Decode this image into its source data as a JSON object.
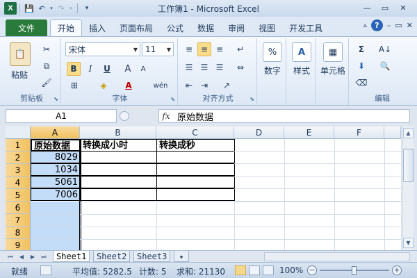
{
  "window": {
    "app_icon": "X",
    "title": "工作簿1 - Microsoft Excel",
    "qat_icons": [
      "save-icon",
      "undo-icon",
      "redo-icon",
      "customize-icon"
    ]
  },
  "tabs": {
    "file": "文件",
    "items": [
      "开始",
      "插入",
      "页面布局",
      "公式",
      "数据",
      "审阅",
      "视图",
      "开发工具"
    ],
    "active": "开始"
  },
  "ribbon": {
    "clipboard": {
      "paste": "粘贴",
      "label": "剪贴板"
    },
    "font": {
      "name": "宋体",
      "size": "11",
      "bold": "B",
      "italic": "I",
      "underline": "U",
      "grow": "A",
      "shrink": "A",
      "label": "字体"
    },
    "alignment": {
      "label": "对齐方式"
    },
    "number": {
      "button": "数字",
      "icon": "%"
    },
    "styles": {
      "button": "样式"
    },
    "cells": {
      "button": "单元格"
    },
    "editing": {
      "label": "编辑",
      "sum": "Σ"
    }
  },
  "formula_bar": {
    "name_box": "A1",
    "fx": "fx",
    "content": "原始数据"
  },
  "grid": {
    "columns": [
      "A",
      "B",
      "C",
      "D",
      "E",
      "F"
    ],
    "rows": [
      "1",
      "2",
      "3",
      "4",
      "5",
      "6",
      "7",
      "8",
      "9"
    ],
    "cells": {
      "A1": "原始数据",
      "B1": "转换成小时",
      "C1": "转换成秒",
      "A2": "8029",
      "A3": "1034",
      "A4": "5061",
      "A5": "7006"
    }
  },
  "sheets": {
    "tabs": [
      "Sheet1",
      "Sheet2",
      "Sheet3"
    ],
    "active": "Sheet1"
  },
  "status": {
    "ready": "就绪",
    "average": "平均值: 5282.5",
    "count": "计数: 5",
    "sum": "求和: 21130",
    "zoom": "100%"
  }
}
